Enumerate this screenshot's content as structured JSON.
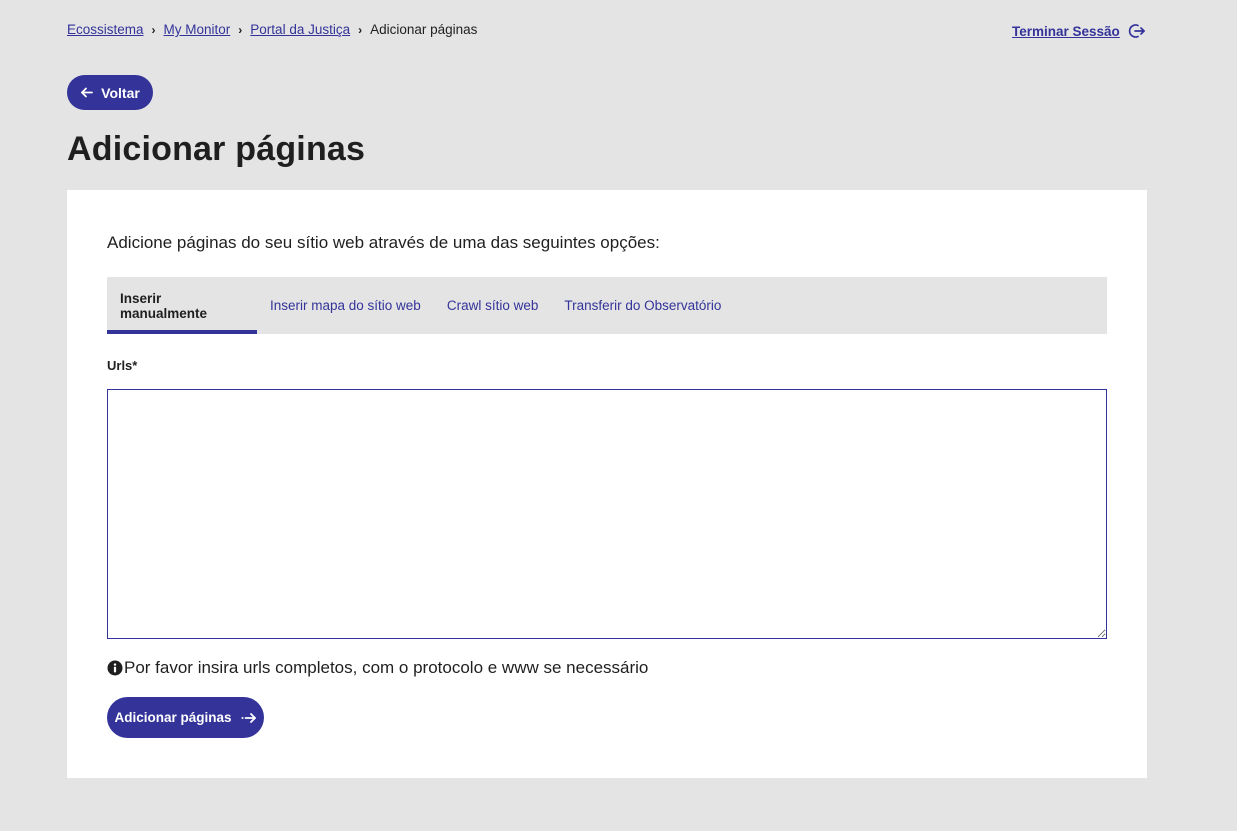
{
  "breadcrumb": {
    "items": [
      {
        "label": "Ecossistema"
      },
      {
        "label": "My Monitor"
      },
      {
        "label": "Portal da Justiça"
      }
    ],
    "current": "Adicionar páginas"
  },
  "header": {
    "logout_label": "Terminar Sessão"
  },
  "back_button": {
    "label": "Voltar"
  },
  "page": {
    "title": "Adicionar páginas",
    "intro": "Adicione páginas do seu sítio web através de uma das seguintes opções:"
  },
  "tabs": [
    {
      "label": "Inserir manualmente",
      "active": true
    },
    {
      "label": "Inserir mapa do sítio web",
      "active": false
    },
    {
      "label": "Crawl sítio web",
      "active": false
    },
    {
      "label": "Transferir do Observatório",
      "active": false
    }
  ],
  "form": {
    "urls_label": "Urls*",
    "urls_value": "",
    "hint": "Por favor insira urls completos, com o protocolo e www se necessário",
    "submit_label": "Adicionar páginas"
  },
  "colors": {
    "accent": "#33339a",
    "background": "#e4e4e4",
    "card": "#ffffff",
    "text": "#1f1f1f"
  }
}
